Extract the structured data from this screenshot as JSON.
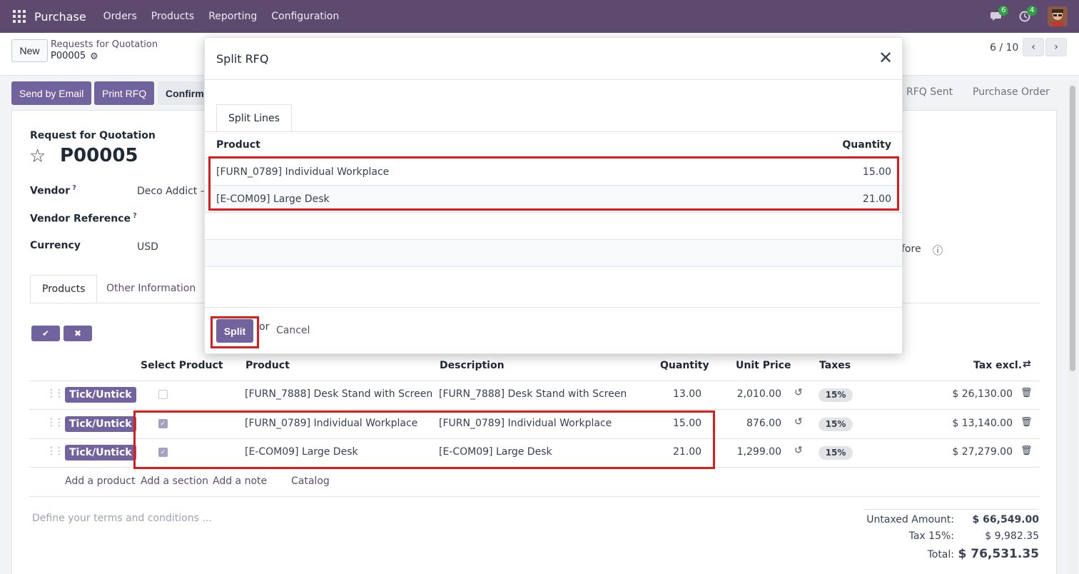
{
  "navbar": {
    "app_name": "Purchase",
    "menu": [
      "Orders",
      "Products",
      "Reporting",
      "Configuration"
    ],
    "messages_count": "6",
    "activities_count": "4"
  },
  "control_panel": {
    "new_label": "New",
    "breadcrumb_parent": "Requests for Quotation",
    "breadcrumb_current": "P00005",
    "pager": "6 / 10"
  },
  "actions": {
    "send_email": "Send by Email",
    "print_rfq": "Print RFQ",
    "confirm": "Confirm"
  },
  "stages": [
    "RFQ Sent",
    "Purchase Order"
  ],
  "form": {
    "doc_type": "Request for Quotation",
    "number": "P00005",
    "vendor_label": "Vendor",
    "vendor_value": "Deco Addict – U",
    "vendor_ref_label": "Vendor Reference",
    "currency_label": "Currency",
    "currency_value": "USD",
    "partial_right_text": "fore",
    "tabs": [
      "Products",
      "Other Information"
    ]
  },
  "lines": {
    "headers": [
      "Select Product",
      "Product",
      "Description",
      "Quantity",
      "Unit Price",
      "Taxes",
      "Tax excl."
    ],
    "tick_label": "Tick/Untick",
    "rows": [
      {
        "product": "[FURN_7888] Desk Stand with Screen",
        "description": "[FURN_7888] Desk Stand with Screen",
        "qty": "13.00",
        "price": "2,010.00",
        "tax": "15%",
        "subtotal": "$ 26,130.00",
        "selected": false
      },
      {
        "product": "[FURN_0789] Individual Workplace",
        "description": "[FURN_0789] Individual Workplace",
        "qty": "15.00",
        "price": "876.00",
        "tax": "15%",
        "subtotal": "$ 13,140.00",
        "selected": true
      },
      {
        "product": "[E-COM09] Large Desk",
        "description": "[E-COM09] Large Desk",
        "qty": "21.00",
        "price": "1,299.00",
        "tax": "15%",
        "subtotal": "$ 27,279.00",
        "selected": true
      }
    ],
    "add_product": "Add a product",
    "add_section": "Add a section",
    "add_note": "Add a note",
    "catalog": "Catalog"
  },
  "terms_placeholder": "Define your terms and conditions ...",
  "totals": {
    "untaxed_label": "Untaxed Amount:",
    "untaxed_value": "$ 66,549.00",
    "tax_label": "Tax 15%:",
    "tax_value": "$ 9,982.35",
    "total_label": "Total:",
    "total_value": "$ 76,531.35"
  },
  "modal": {
    "title": "Split RFQ",
    "tab": "Split Lines",
    "col_product": "Product",
    "col_quantity": "Quantity",
    "rows": [
      {
        "product": "[FURN_0789] Individual Workplace",
        "qty": "15.00"
      },
      {
        "product": "[E-COM09] Large Desk",
        "qty": "21.00"
      }
    ],
    "split_label": "Split",
    "or_label": "or",
    "cancel_label": "Cancel"
  },
  "colors": {
    "navbar": "#5e4a6e",
    "primary": "#71639e",
    "highlight": "#e01b1b"
  }
}
